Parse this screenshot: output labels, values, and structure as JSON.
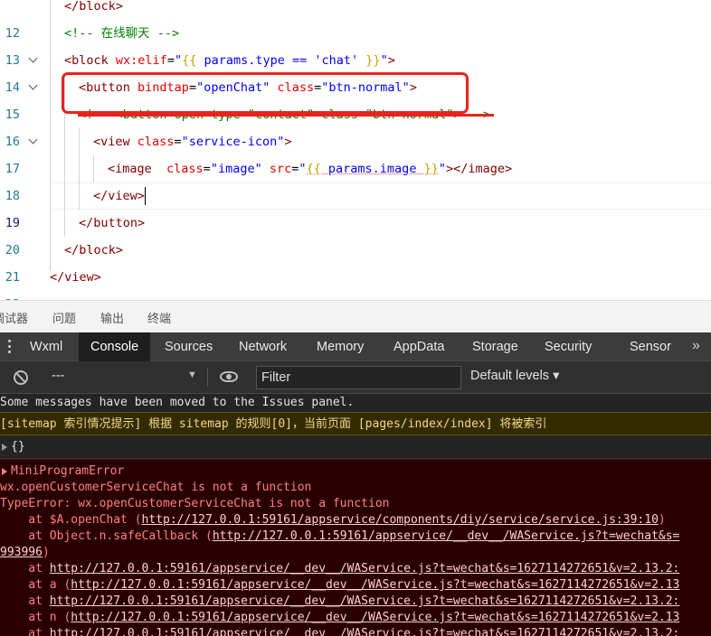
{
  "editor": {
    "lines": [
      {
        "no": "12",
        "parts": [
          {
            "c": "t-tag",
            "t": "</block>"
          }
        ]
      },
      {
        "no": "13",
        "parts": [
          {
            "c": "t-com",
            "t": "<!-- 在线聊天 -->"
          }
        ]
      },
      {
        "no": "14",
        "parts": [
          {
            "c": "t-tag",
            "t": "<block "
          },
          {
            "c": "t-attr",
            "t": "wx:elif"
          },
          {
            "c": "t-plain",
            "t": "="
          },
          {
            "c": "t-val",
            "t": "\""
          },
          {
            "c": "t-brace",
            "t": "{{"
          },
          {
            "c": "t-val",
            "t": " params.type == 'chat' "
          },
          {
            "c": "t-brace",
            "t": "}}"
          },
          {
            "c": "t-val",
            "t": "\""
          },
          {
            "c": "t-tag",
            "t": ">"
          }
        ]
      },
      {
        "no": "15",
        "parts": [
          {
            "c": "t-tag",
            "t": "<button "
          },
          {
            "c": "t-attr",
            "t": "bindtap"
          },
          {
            "c": "t-plain",
            "t": "="
          },
          {
            "c": "t-val",
            "t": "\"openChat\""
          },
          {
            "c": "t-attr",
            "t": " class"
          },
          {
            "c": "t-plain",
            "t": "="
          },
          {
            "c": "t-val",
            "t": "\"btn-normal\""
          },
          {
            "c": "t-tag",
            "t": ">"
          }
        ]
      },
      {
        "no": "16",
        "parts": [
          {
            "c": "t-com",
            "t": "<!-- <button open-type=\"contact\" class=\"btn-normal\"> -->"
          }
        ]
      },
      {
        "no": "17",
        "parts": [
          {
            "c": "t-tag",
            "t": "<view "
          },
          {
            "c": "t-attr",
            "t": "class"
          },
          {
            "c": "t-plain",
            "t": "="
          },
          {
            "c": "t-val",
            "t": "\"service-icon\""
          },
          {
            "c": "t-tag",
            "t": ">"
          }
        ]
      },
      {
        "no": "18",
        "parts": [
          {
            "c": "t-tag",
            "t": "<image  "
          },
          {
            "c": "t-attr",
            "t": "class"
          },
          {
            "c": "t-plain",
            "t": "="
          },
          {
            "c": "t-val",
            "t": "\"image\""
          },
          {
            "c": "t-attr",
            "t": " src"
          },
          {
            "c": "t-plain",
            "t": "="
          },
          {
            "c": "t-val",
            "t": "\""
          },
          {
            "c": "t-brace t-u",
            "t": "{{"
          },
          {
            "c": "t-val t-u",
            "t": " params.image "
          },
          {
            "c": "t-brace t-u",
            "t": "}}"
          },
          {
            "c": "t-val",
            "t": "\""
          },
          {
            "c": "t-tag",
            "t": "></image>"
          }
        ]
      },
      {
        "no": "19",
        "parts": [
          {
            "c": "t-tag",
            "t": "</view>"
          }
        ]
      },
      {
        "no": "20",
        "parts": [
          {
            "c": "t-tag",
            "t": "</button>"
          }
        ]
      },
      {
        "no": "21",
        "parts": [
          {
            "c": "t-tag",
            "t": "</block>"
          }
        ]
      },
      {
        "no": "22",
        "parts": [
          {
            "c": "t-tag",
            "t": "</view>"
          }
        ]
      }
    ]
  },
  "panel_tabs": [
    "调试器",
    "问题",
    "输出",
    "终端"
  ],
  "devtools": {
    "tabs": [
      "Wxml",
      "Console",
      "Sources",
      "Network",
      "Memory",
      "AppData",
      "Storage",
      "Security",
      "Sensor"
    ],
    "active_tab": "Console",
    "more_icon": "»",
    "context_value": "---",
    "filter_placeholder": "Filter",
    "levels_label": "Default levels ▾"
  },
  "console": {
    "info": "Some messages have been moved to the Issues panel.",
    "warning": "[sitemap 索引情况提示] 根据 sitemap 的规则[0]，当前页面 [pages/index/index] 将被索引",
    "object": "{}",
    "error": {
      "title": "MiniProgramError",
      "message": "wx.openCustomerServiceChat is not a function",
      "type_line": "TypeError: wx.openCustomerServiceChat is not a function",
      "stack": [
        {
          "prefix": "    at $A.openChat (",
          "link": "http://127.0.0.1:59161/appservice/components/diy/service/service.js:39:10",
          "suffix": ")"
        },
        {
          "prefix": "    at Object.n.safeCallback (",
          "link": "http://127.0.0.1:59161/appservice/__dev__/WAService.js?t=wechat&s=",
          "suffix": ""
        },
        {
          "prefix": "",
          "link": "993996",
          "suffix": ")"
        },
        {
          "prefix": "    at ",
          "link": "http://127.0.0.1:59161/appservice/__dev__/WAService.js?t=wechat&s=1627114272651&v=2.13.2:",
          "suffix": ""
        },
        {
          "prefix": "    at a (",
          "link": "http://127.0.0.1:59161/appservice/__dev__/WAService.js?t=wechat&s=1627114272651&v=2.13",
          "suffix": ""
        },
        {
          "prefix": "    at ",
          "link": "http://127.0.0.1:59161/appservice/__dev__/WAService.js?t=wechat&s=1627114272651&v=2.13.2:",
          "suffix": ""
        },
        {
          "prefix": "    at n (",
          "link": "http://127.0.0.1:59161/appservice/__dev__/WAService.js?t=wechat&s=1627114272651&v=2.13",
          "suffix": ""
        },
        {
          "prefix": "    at ",
          "link": "http://127.0.0.1:59161/appservice/__dev__/WAService.js?t=wechat&s=1627114272651&v=2.13.2:",
          "suffix": ""
        }
      ]
    }
  },
  "colors": {
    "annotation": "#e8231e",
    "console_bg": "#242424",
    "error_bg": "#290000",
    "warning_bg": "#332b00"
  }
}
